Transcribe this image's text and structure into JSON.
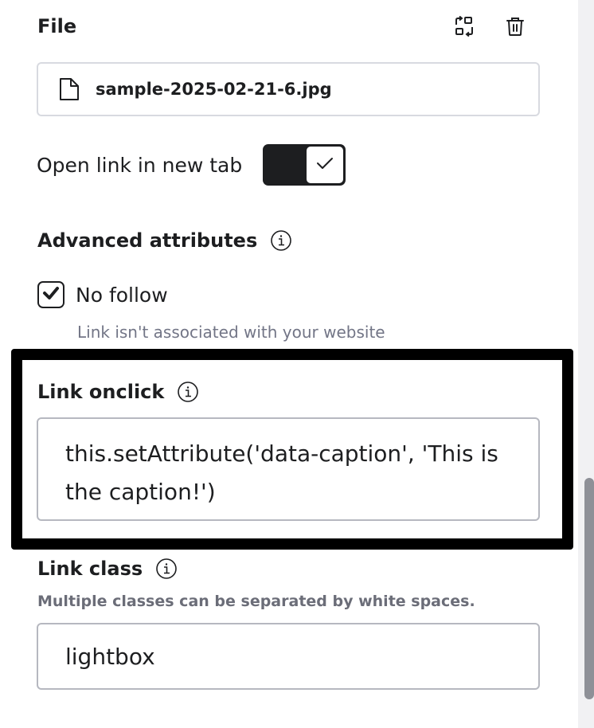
{
  "file": {
    "title": "File",
    "name": "sample-2025-02-21-6.jpg",
    "replace_icon": "replace-icon",
    "delete_icon": "trash-icon"
  },
  "new_tab": {
    "label": "Open link in new tab",
    "enabled": true
  },
  "advanced": {
    "title": "Advanced attributes",
    "no_follow": {
      "label": "No follow",
      "checked": true,
      "hint": "Link isn't associated with your website"
    }
  },
  "onclick": {
    "title": "Link onclick",
    "value": "this.setAttribute('data-caption', 'This is the caption!')"
  },
  "link_class": {
    "title": "Link class",
    "hint": "Multiple classes can be separated by white spaces.",
    "value": "lightbox"
  },
  "colors": {
    "text": "#1d1e20",
    "muted": "#727586",
    "border": "#d8dae0",
    "highlight": "#000000"
  }
}
